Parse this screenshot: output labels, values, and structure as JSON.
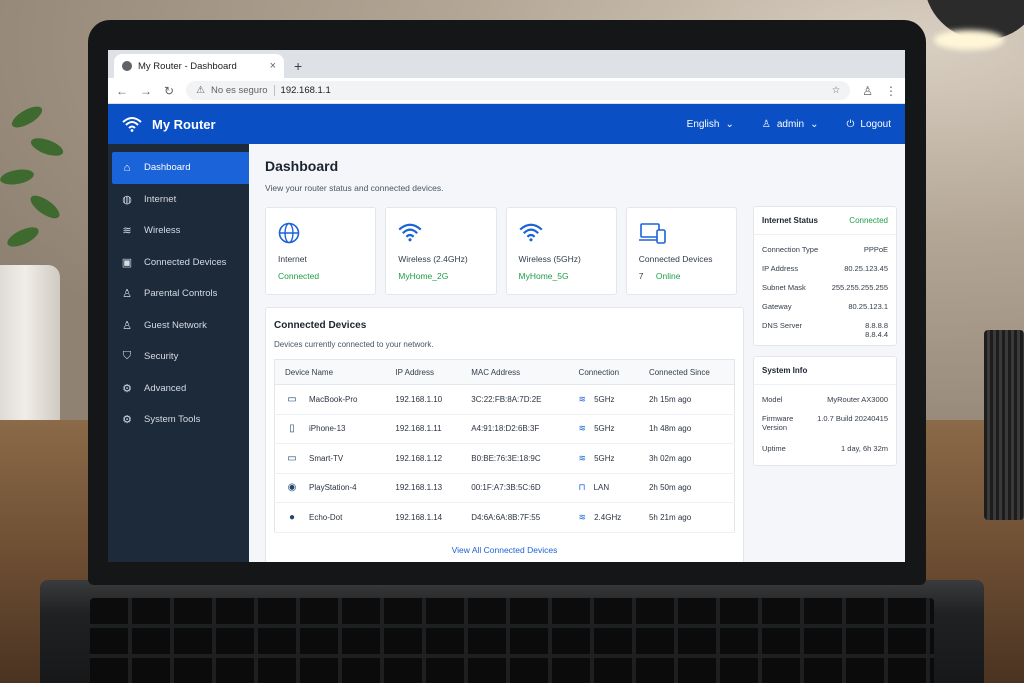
{
  "browser": {
    "tab_title": "My Router - Dashboard",
    "tab_close": "×",
    "new_tab": "+",
    "not_secure": "No es seguro",
    "url": "192.168.1.1"
  },
  "header": {
    "brand": "My Router",
    "language": "English",
    "user": "admin",
    "logout": "Logout"
  },
  "sidebar": {
    "items": [
      {
        "label": "Dashboard",
        "icon": "home-icon"
      },
      {
        "label": "Internet",
        "icon": "globe-icon"
      },
      {
        "label": "Wireless",
        "icon": "wifi-icon"
      },
      {
        "label": "Connected Devices",
        "icon": "devices-icon"
      },
      {
        "label": "Parental Controls",
        "icon": "user-icon"
      },
      {
        "label": "Guest Network",
        "icon": "users-icon"
      },
      {
        "label": "Security",
        "icon": "shield-icon"
      },
      {
        "label": "Advanced",
        "icon": "gear-icon"
      },
      {
        "label": "System Tools",
        "icon": "tools-icon"
      }
    ]
  },
  "main": {
    "title": "Dashboard",
    "subtitle": "View your router status and connected devices.",
    "cards": [
      {
        "title": "Internet",
        "value": "Connected"
      },
      {
        "title": "Wireless (2.4GHz)",
        "value": "MyHome_2G"
      },
      {
        "title": "Wireless (5GHz)",
        "value": "MyHome_5G"
      },
      {
        "title": "Connected Devices",
        "count": "7",
        "value": "Online"
      }
    ]
  },
  "devices": {
    "title": "Connected Devices",
    "subtitle": "Devices currently connected to your network.",
    "columns": [
      "Device Name",
      "IP Address",
      "MAC Address",
      "Connection",
      "Connected Since"
    ],
    "rows": [
      {
        "name": "MacBook-Pro",
        "ip": "192.168.1.10",
        "mac": "3C:22:FB:8A:7D:2E",
        "conn": "5GHz",
        "since": "2h 15m ago"
      },
      {
        "name": "iPhone-13",
        "ip": "192.168.1.11",
        "mac": "A4:91:18:D2:6B:3F",
        "conn": "5GHz",
        "since": "1h 48m ago"
      },
      {
        "name": "Smart-TV",
        "ip": "192.168.1.12",
        "mac": "B0:BE:76:3E:18:9C",
        "conn": "5GHz",
        "since": "3h 02m ago"
      },
      {
        "name": "PlayStation-4",
        "ip": "192.168.1.13",
        "mac": "00:1F:A7:3B:5C:6D",
        "conn": "LAN",
        "since": "2h 50m ago"
      },
      {
        "name": "Echo-Dot",
        "ip": "192.168.1.14",
        "mac": "D4:6A:6A:8B:7F:55",
        "conn": "2.4GHz",
        "since": "5h 21m ago"
      }
    ],
    "view_all": "View All Connected Devices"
  },
  "internet_status": {
    "title": "Internet Status",
    "status": "Connected",
    "fields": [
      {
        "k": "Connection Type",
        "v": "PPPoE"
      },
      {
        "k": "IP Address",
        "v": "80.25.123.45"
      },
      {
        "k": "Subnet Mask",
        "v": "255.255.255.255"
      },
      {
        "k": "Gateway",
        "v": "80.25.123.1"
      },
      {
        "k": "DNS Server",
        "v": "8.8.8.8",
        "v2": "8.8.4.4"
      }
    ]
  },
  "system_info": {
    "title": "System Info",
    "fields": [
      {
        "k": "Model",
        "v": "MyRouter AX3000"
      },
      {
        "k": "Firmware Version",
        "v": "1.0.7 Build 20240415"
      },
      {
        "k": "Uptime",
        "v": "1 day, 6h 32m"
      }
    ]
  },
  "colors": {
    "header_blue": "#0a4fc4",
    "sidebar_bg": "#1d2a3a",
    "active_blue": "#1a63d8",
    "status_green": "#1e9e46"
  }
}
